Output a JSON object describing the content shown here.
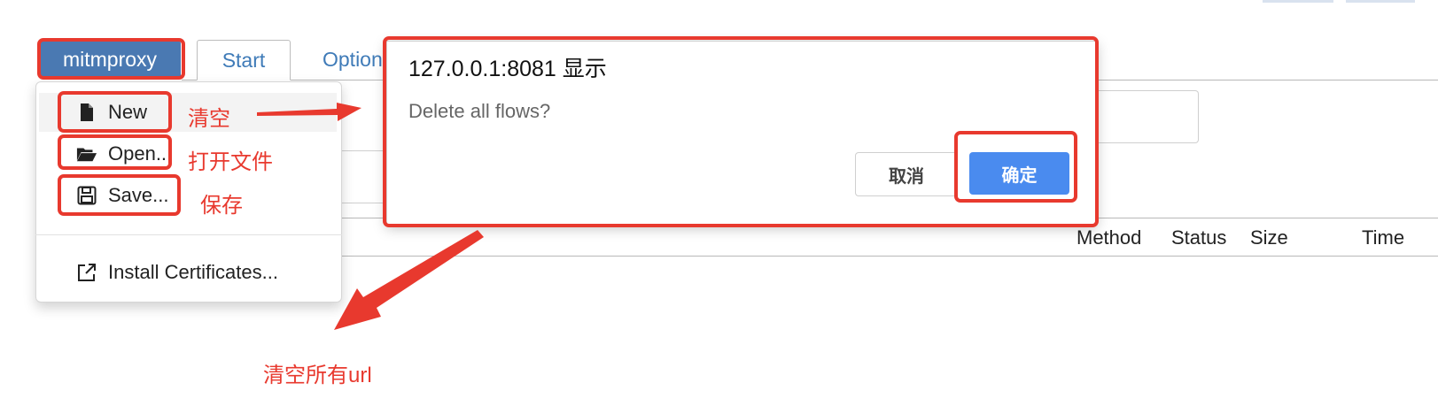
{
  "top_tabs": {
    "brand": "mitmproxy",
    "start": "Start",
    "options": "Option"
  },
  "menu": {
    "items": [
      {
        "label": "New",
        "icon": "file-icon"
      },
      {
        "label": "Open...",
        "icon": "folder-open-icon"
      },
      {
        "label": "Save...",
        "icon": "save-icon"
      },
      {
        "label": "Install Certificates...",
        "icon": "external-link-icon"
      }
    ]
  },
  "dialog": {
    "title": "127.0.0.1:8081 显示",
    "message": "Delete all flows?",
    "cancel_label": "取消",
    "ok_label": "确定"
  },
  "table": {
    "columns": [
      "Method",
      "Status",
      "Size",
      "Time"
    ]
  },
  "annotations": {
    "new_note": "清空",
    "open_note": "打开文件",
    "save_note": "保存",
    "bottom_note": "清空所有url"
  },
  "colors": {
    "brand_blue": "#4a79b2",
    "link_blue": "#3f7bb8",
    "ok_blue": "#4a8bef",
    "annotation_red": "#e8392e"
  }
}
